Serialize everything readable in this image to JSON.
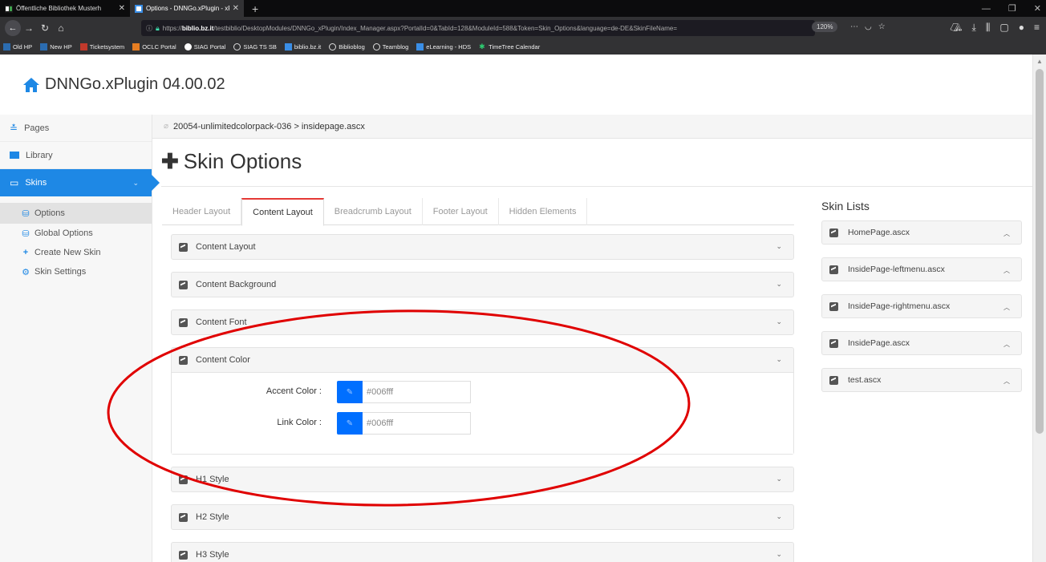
{
  "browser": {
    "tabs": [
      {
        "title": "Öffentliche Bibliothek Musterh",
        "active": false
      },
      {
        "title": "Options - DNNGo.xPlugin - xP",
        "active": true
      }
    ],
    "url_prefix": "https://",
    "url_host": "biblio.bz.it",
    "url_path": "/testbiblio/DesktopModules/DNNGo_xPlugin/Index_Manager.aspx?PortalId=0&TabId=128&ModuleId=588&Token=Skin_Options&language=de-DE&SkinFileName=",
    "zoom": "120%",
    "bookmarks": [
      "Old HP",
      "New HP",
      "Ticketsystem",
      "OCLC Portal",
      "SIAG Portal",
      "SIAG TS SB",
      "biblio.bz.it",
      "Biblioblog",
      "Teamblog",
      "eLearning - HDS",
      "TimeTree Calendar"
    ]
  },
  "app": {
    "title": "DNNGo.xPlugin 04.00.02"
  },
  "sidebar": {
    "items": [
      {
        "label": "Pages"
      },
      {
        "label": "Library"
      },
      {
        "label": "Skins"
      }
    ],
    "subitems": [
      {
        "label": "Options"
      },
      {
        "label": "Global Options"
      },
      {
        "label": "Create New Skin"
      },
      {
        "label": "Skin Settings"
      }
    ]
  },
  "breadcrumb": "20054-unlimitedcolorpack-036 > insidepage.ascx",
  "main": {
    "title": "Skin Options",
    "tabs": [
      "Header Layout",
      "Content Layout",
      "Breadcrumb Layout",
      "Footer Layout",
      "Hidden Elements"
    ],
    "selected_tab": "Content Layout",
    "panels": [
      "Content Layout",
      "Content Background",
      "Content Font",
      "Content Color",
      "H1 Style",
      "H2 Style",
      "H3 Style"
    ],
    "expanded_panel": "Content Color",
    "colors": [
      {
        "label": "Accent Color :",
        "value": "#006fff"
      },
      {
        "label": "Link Color :",
        "value": "#006fff"
      }
    ]
  },
  "skin_lists": {
    "title": "Skin Lists",
    "items": [
      "HomePage.ascx",
      "InsidePage-leftmenu.ascx",
      "InsidePage-rightmenu.ascx",
      "InsidePage.ascx",
      "test.ascx"
    ]
  },
  "colors": {
    "accent": "#1e88e5",
    "swatch": "#006fff",
    "tab_highlight": "#e53935",
    "annotation": "#e00000"
  }
}
